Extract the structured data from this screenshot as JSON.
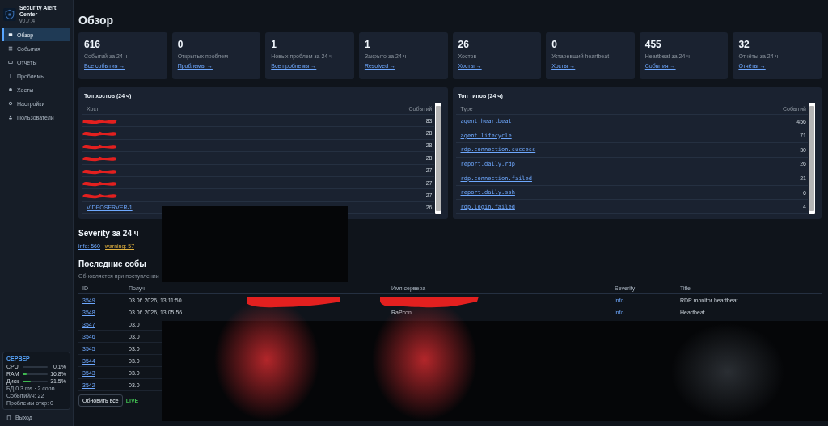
{
  "app": {
    "title": "Security Alert Center",
    "version": "v0.7.4"
  },
  "nav": [
    {
      "label": "Обзор",
      "selected": true
    },
    {
      "label": "События",
      "selected": false
    },
    {
      "label": "Отчёты",
      "selected": false
    },
    {
      "label": "Проблемы",
      "selected": false
    },
    {
      "label": "Хосты",
      "selected": false
    },
    {
      "label": "Настройки",
      "selected": false
    },
    {
      "label": "Пользователи",
      "selected": false
    }
  ],
  "server": {
    "title": "СЕРВЕР",
    "meters": [
      {
        "label": "CPU",
        "level": 0.001,
        "reading": "0.1%"
      },
      {
        "label": "RAM",
        "level": 0.168,
        "reading": "16.8%"
      },
      {
        "label": "Диск",
        "level": 0.315,
        "reading": "31.5%"
      }
    ],
    "lines": [
      "БД 0.3 ms · 2 conn",
      "Событий/ч: 22",
      "Проблемы откр: 0"
    ]
  },
  "logout": "Выход",
  "page_title": "Обзор",
  "cards": [
    {
      "value": "616",
      "label": "Событий за 24 ч",
      "link": "Все события →"
    },
    {
      "value": "0",
      "label": "Открытых проблем",
      "link": "Проблемы →"
    },
    {
      "value": "1",
      "label": "Новых проблем за 24 ч",
      "link": "Все проблемы →"
    },
    {
      "value": "1",
      "label": "Закрыто за 24 ч",
      "link": "Resolved →"
    },
    {
      "value": "26",
      "label": "Хостов",
      "link": "Хосты →"
    },
    {
      "value": "0",
      "label": "Устаревший heartbeat",
      "link": "Хосты →"
    },
    {
      "value": "455",
      "label": "Heartbeat за 24 ч",
      "link": "События →"
    },
    {
      "value": "32",
      "label": "Отчёты за 24 ч",
      "link": "Отчёты →"
    }
  ],
  "top_hosts": {
    "title": "Топ хостов (24 ч)",
    "columns": [
      "Хост",
      "Событий"
    ],
    "rows": [
      {
        "count": "83"
      },
      {
        "count": "28"
      },
      {
        "count": "28"
      },
      {
        "count": "28"
      },
      {
        "count": "27"
      },
      {
        "count": "27"
      },
      {
        "count": "27"
      },
      {
        "name": "VIDEOSERVER-1",
        "count": "26"
      }
    ]
  },
  "top_types": {
    "title": "Топ типов (24 ч)",
    "columns": [
      "Type",
      "Событий"
    ],
    "rows": [
      {
        "name": "agent.heartbeat",
        "count": "456"
      },
      {
        "name": "agent.lifecycle",
        "count": "71"
      },
      {
        "name": "rdp.connection.success",
        "count": "30"
      },
      {
        "name": "report.daily.rdp",
        "count": "26"
      },
      {
        "name": "rdp.connection.failed",
        "count": "21"
      },
      {
        "name": "report.daily.ssh",
        "count": "6"
      },
      {
        "name": "rdp.login.failed",
        "count": "4"
      }
    ]
  },
  "severity": {
    "title": "Severity за 24 ч",
    "chips": [
      {
        "label": "info: 560",
        "color": "#6ea8fe"
      },
      {
        "label": "warning: 57",
        "color": "#e3b341"
      }
    ]
  },
  "recent": {
    "title": "Последние собы",
    "subtitle": "Обновляется при поступлении",
    "columns": [
      "ID",
      "Получ",
      null,
      "Имя сервера",
      "Severity",
      "Title"
    ],
    "rows": [
      {
        "id": "3549",
        "time": "03.06.2026, 13:11:50",
        "severity": "info",
        "title": "RDP monitor heartbeat"
      },
      {
        "id": "3548",
        "time": "03.06.2026, 13:05:56",
        "server": "RaPcon",
        "severity": "info",
        "title": "Heartbeat"
      },
      {
        "id": "3547",
        "time": "03.0"
      },
      {
        "id": "3546",
        "time": "03.0"
      },
      {
        "id": "3545",
        "time": "03.0"
      },
      {
        "id": "3544",
        "time": "03.0"
      },
      {
        "id": "3543",
        "time": "03.0"
      },
      {
        "id": "3542",
        "time": "03.0"
      }
    ]
  },
  "refresh_button": "Обновить всё",
  "live": "LIVE"
}
